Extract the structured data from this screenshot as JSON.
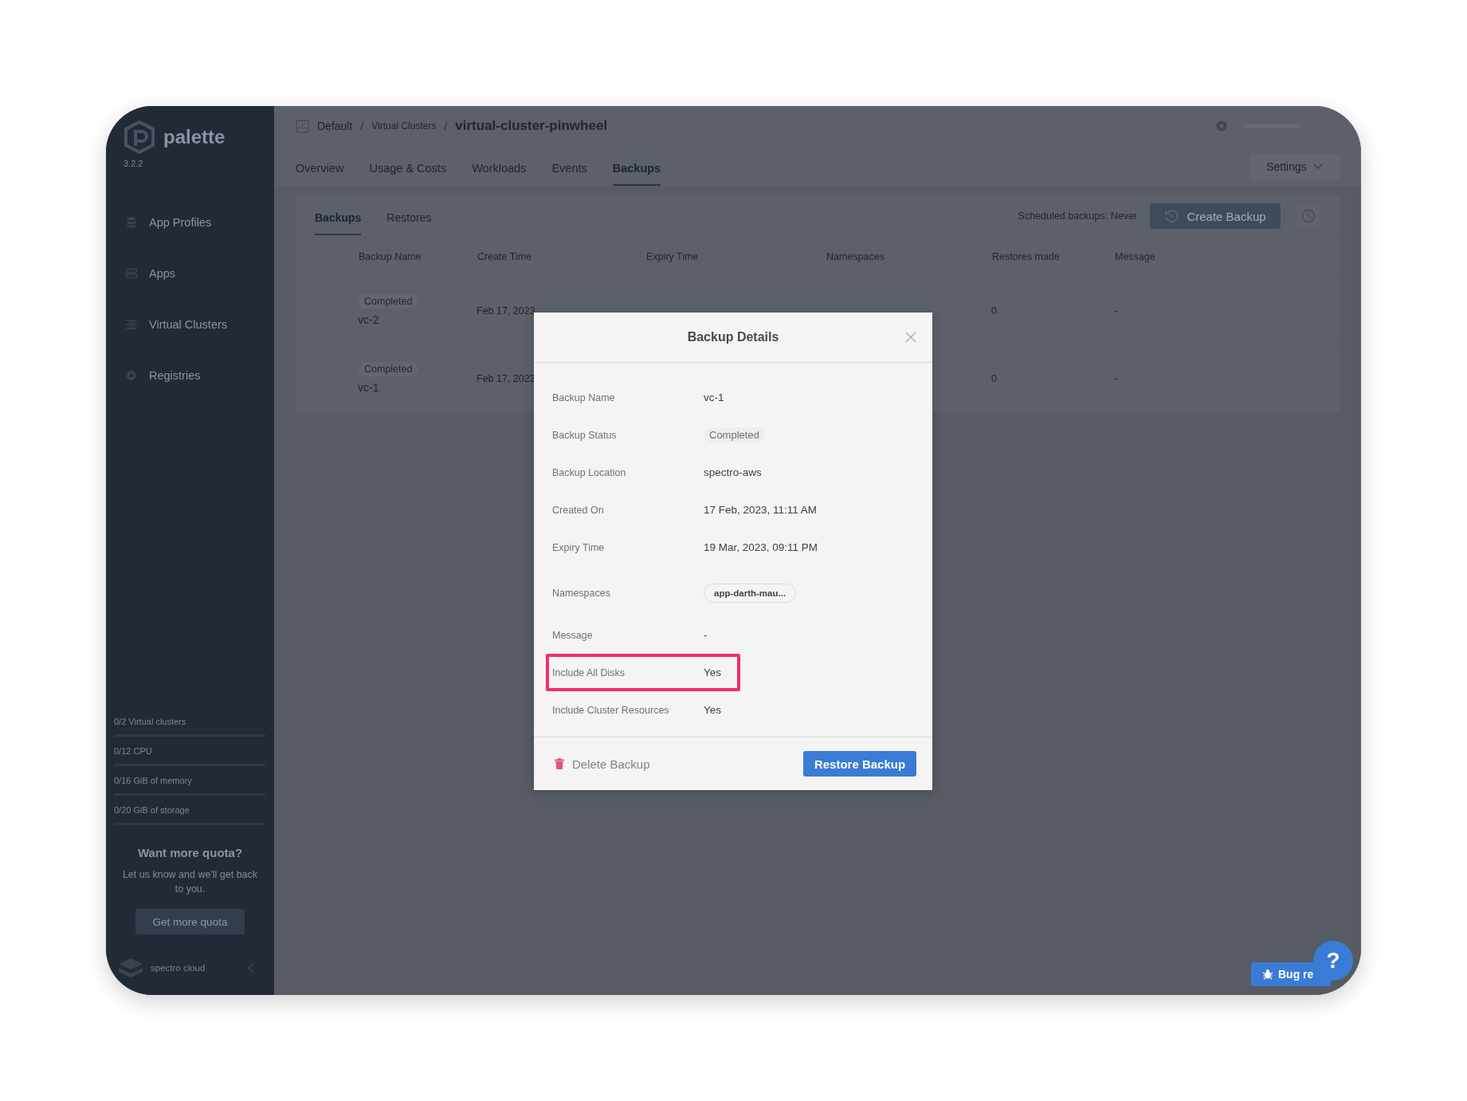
{
  "sidebar": {
    "logo": "palette",
    "version": "3.2.2",
    "items": [
      {
        "label": "App Profiles"
      },
      {
        "label": "Apps"
      },
      {
        "label": "Virtual Clusters"
      },
      {
        "label": "Registries"
      }
    ],
    "quotas": [
      {
        "label": "0/2 Virtual clusters"
      },
      {
        "label": "0/12 CPU"
      },
      {
        "label": "0/16 GiB of memory"
      },
      {
        "label": "0/20 GiB of storage"
      }
    ],
    "promo": {
      "title": "Want more quota?",
      "text": "Let us know and we'll get back to you.",
      "button": "Get more quota"
    },
    "footer_logo": "spectro cloud"
  },
  "breadcrumb": [
    {
      "label": "Default"
    },
    {
      "separator": "/",
      "label": "Virtual Clusters"
    },
    {
      "separator": "/",
      "label": "virtual-cluster-pinwheel"
    }
  ],
  "tabs": [
    {
      "label": "Overview",
      "selected": false
    },
    {
      "label": "Usage & Costs",
      "selected": false
    },
    {
      "label": "Workloads",
      "selected": false
    },
    {
      "label": "Events",
      "selected": false
    },
    {
      "label": "Backups",
      "selected": true
    }
  ],
  "settings_button": "Settings",
  "panel": {
    "tabs": [
      {
        "label": "Backups",
        "selected": true
      },
      {
        "label": "Restores",
        "selected": false
      }
    ],
    "schedule": "Scheduled backups: Never",
    "create_button": "Create Backup",
    "table": {
      "columns": [
        "Backup Name",
        "Create Time",
        "Expiry Time",
        "Namespaces",
        "Restores made",
        "Message"
      ],
      "rows": [
        {
          "status": "Completed",
          "name": "vc-2",
          "create_time": "Feb 17, 2023",
          "restores": "0",
          "message": "-"
        },
        {
          "status": "Completed",
          "name": "vc-1",
          "create_time": "Feb 17, 2023",
          "restores": "0",
          "message": "-"
        }
      ]
    }
  },
  "dialog": {
    "title": "Backup Details",
    "fields": [
      {
        "label": "Backup Name",
        "value": "vc-1",
        "kind": "text",
        "highlighted": false
      },
      {
        "label": "Backup Status",
        "value": "Completed",
        "kind": "status",
        "highlighted": false
      },
      {
        "label": "Backup Location",
        "value": "spectro-aws",
        "kind": "text",
        "highlighted": false
      },
      {
        "label": "Created On",
        "value": "17 Feb, 2023, 11:11 AM",
        "kind": "text",
        "highlighted": false
      },
      {
        "label": "Expiry Time",
        "value": "19 Mar, 2023, 09:11 PM",
        "kind": "text",
        "highlighted": false
      },
      {
        "label": "Namespaces",
        "value": "app-darth-mau...",
        "kind": "tag",
        "highlighted": false
      },
      {
        "label": "Message",
        "value": "-",
        "kind": "text",
        "highlighted": false
      },
      {
        "label": "Include All Disks",
        "value": "Yes",
        "kind": "text",
        "highlighted": true
      },
      {
        "label": "Include Cluster Resources",
        "value": "Yes",
        "kind": "text",
        "highlighted": false
      }
    ],
    "delete_button": "Delete Backup",
    "restore_button": "Restore Backup"
  },
  "bug_report": "Bug re",
  "help": "?"
}
